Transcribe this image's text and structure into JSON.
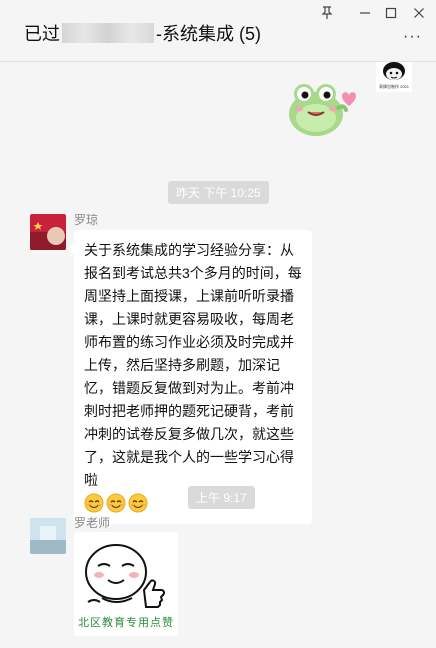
{
  "window": {
    "title_prefix": "已过",
    "title_suffix": "-系统集成 (5)",
    "controls": [
      "pin-icon",
      "minimize-icon",
      "maximize-icon",
      "close-icon"
    ],
    "more_label": "···"
  },
  "stickers": {
    "avatar_sticker_caption": "表情包制作 2021"
  },
  "messages": [
    {
      "type": "time",
      "text": "昨天 下午 10:25"
    },
    {
      "type": "text",
      "sender": "罗琼",
      "text": "关于系统集成的学习经验分享：从报名到考试总共3个多月的时间，每周坚持上面授课，上课前听听录播课，上课时就更容易吸收，每周老师布置的练习作业必须及时完成并上传，然后坚持多刷题，加深记忆，错题反复做到对为止。考前冲刺时把老师押的题死记硬背，考前冲刺的试卷反复多做几次，就这些了，这就是我个人的一些学习心得啦",
      "emoji": [
        "smile-emoji",
        "smile-emoji",
        "smile-emoji"
      ]
    },
    {
      "type": "time",
      "text": "上午 9:17"
    },
    {
      "type": "image",
      "sender": "罗老师",
      "watermark": "北区教育专用点赞"
    }
  ],
  "colors": {
    "background": "#f5f5f5",
    "bubble": "#ffffff",
    "time_chip": "#dadada",
    "watermark": "#2a8f3a"
  }
}
